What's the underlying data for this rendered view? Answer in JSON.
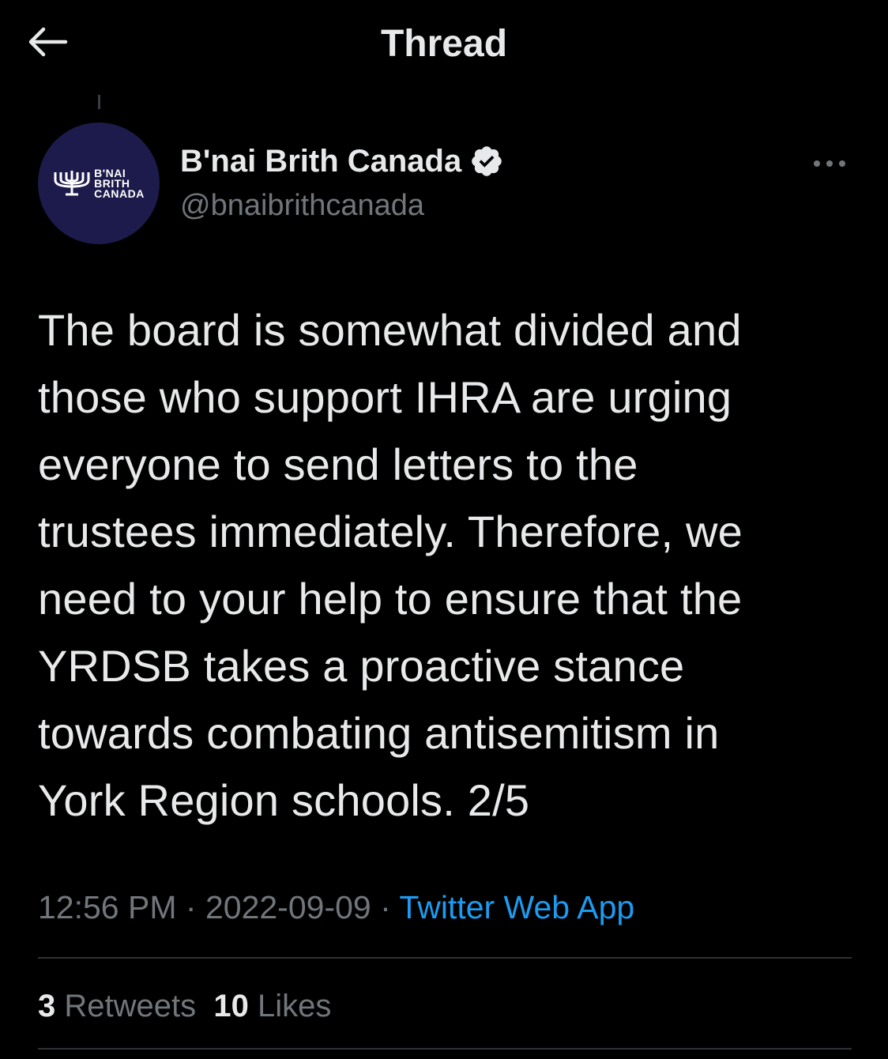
{
  "header": {
    "title": "Thread",
    "back_icon": "arrow-left-icon"
  },
  "tweet": {
    "avatar": {
      "logo_lines": [
        "B'NAI",
        "BRITH",
        "CANADA"
      ],
      "logo_icon": "menorah-icon",
      "background_color": "#1d1b4c"
    },
    "author_name": "B'nai Brith Canada",
    "verified_icon": "verified-badge-icon",
    "author_handle": "@bnaibrithcanada",
    "more_icon": "more-horizontal-icon",
    "text": "The board is somewhat divided and\nthose who support IHRA are urging\neveryone to send letters to the\ntrustees immediately. Therefore, we\nneed to your help to ensure that the\nYRDSB takes a proactive stance\ntowards combating antisemitism in\nYork Region schools. 2/5",
    "time": "12:56 PM",
    "separator": "·",
    "date": "2022-09-09",
    "source": "Twitter Web App"
  },
  "stats": {
    "retweets_count": "3",
    "retweets_label": "Retweets",
    "likes_count": "10",
    "likes_label": "Likes"
  },
  "colors": {
    "background": "#000000",
    "primary_text": "#e7e9ea",
    "secondary_text": "#71767b",
    "link": "#1d9bf0",
    "divider": "#2f3336"
  }
}
